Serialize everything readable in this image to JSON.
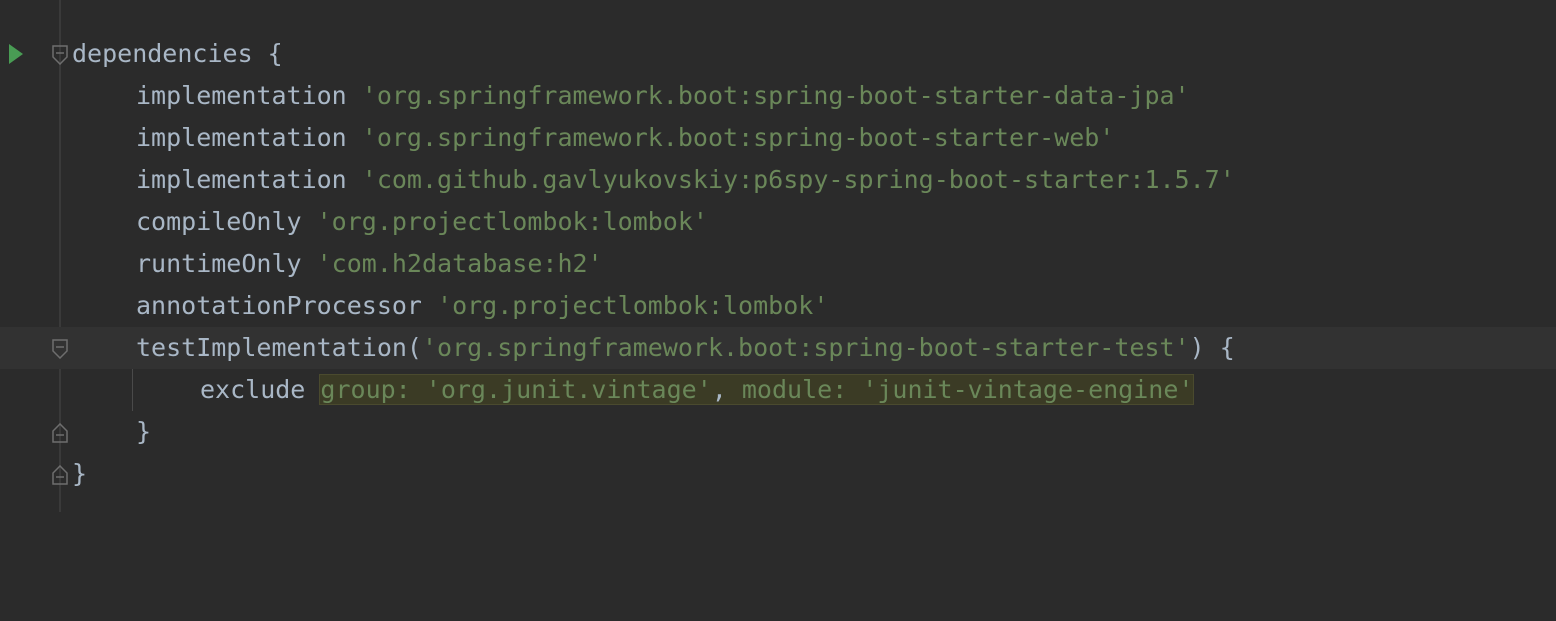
{
  "editor": {
    "lines": [
      {
        "kw": "dependencies",
        "text": " {"
      },
      {
        "kw": "implementation ",
        "str": "'org.springframework.boot:spring-boot-starter-data-jpa'"
      },
      {
        "kw": "implementation ",
        "str": "'org.springframework.boot:spring-boot-starter-web'"
      },
      {
        "kw": "implementation ",
        "str": "'com.github.gavlyukovskiy:p6spy-spring-boot-starter:1.5.7'"
      },
      {
        "kw": "compileOnly ",
        "str": "'org.projectlombok:lombok'"
      },
      {
        "kw": "runtimeOnly ",
        "str": "'com.h2database:h2'"
      },
      {
        "kw": "annotationProcessor ",
        "str": "'org.projectlombok:lombok'"
      },
      {
        "kw": "testImplementation(",
        "str": "'org.springframework.boot:spring-boot-starter-test'",
        "tail": ") {"
      },
      {
        "kw": "exclude ",
        "label1": "group: ",
        "str1": "'org.junit.vintage'",
        "sep": ", ",
        "label2": "module: ",
        "str2": "'junit-vintage-engine'"
      },
      {
        "text": "}"
      },
      {
        "text": "}"
      }
    ]
  }
}
